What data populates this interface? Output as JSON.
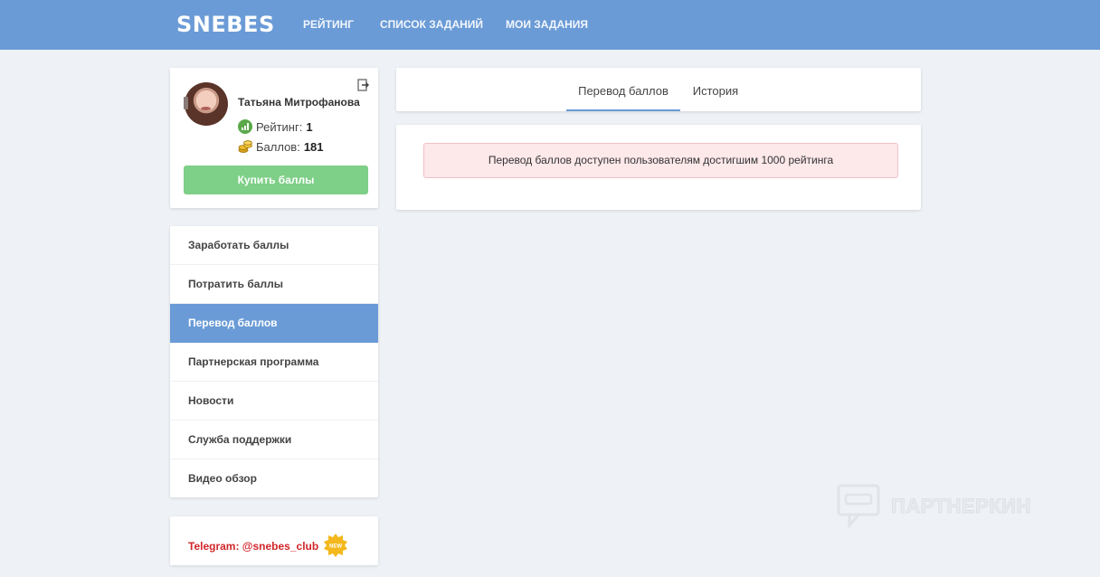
{
  "header": {
    "logo": "SNEBES",
    "nav": [
      "РЕЙТИНГ",
      "СПИСОК ЗАДАНИЙ",
      "МОИ ЗАДАНИЯ"
    ]
  },
  "profile": {
    "name": "Татьяна Митрофанова",
    "rating_label": "Рейтинг:",
    "rating_value": "1",
    "points_label": "Баллов:",
    "points_value": "181",
    "buy_button": "Купить баллы"
  },
  "menu": {
    "items": [
      {
        "label": "Заработать баллы",
        "active": false
      },
      {
        "label": "Потратить баллы",
        "active": false
      },
      {
        "label": "Перевод баллов",
        "active": true
      },
      {
        "label": "Партнерская программа",
        "active": false
      },
      {
        "label": "Новости",
        "active": false
      },
      {
        "label": "Служба поддержки",
        "active": false
      },
      {
        "label": "Видео обзор",
        "active": false
      }
    ]
  },
  "telegram": {
    "link": "Telegram: @snebes_club",
    "badge": "NEW"
  },
  "tabs": {
    "items": [
      "Перевод баллов",
      "История"
    ],
    "active_index": 0
  },
  "alert": {
    "message": "Перевод баллов доступен пользователям достигшим 1000 рейтинга"
  },
  "watermark": {
    "text": "ПАРТНЕРКИН"
  },
  "colors": {
    "header_bg": "#6a9bd6",
    "active_menu": "#6a9bd6",
    "buy_button": "#7ecf87",
    "alert_bg": "#fde8ea",
    "telegram": "#d2262a"
  }
}
